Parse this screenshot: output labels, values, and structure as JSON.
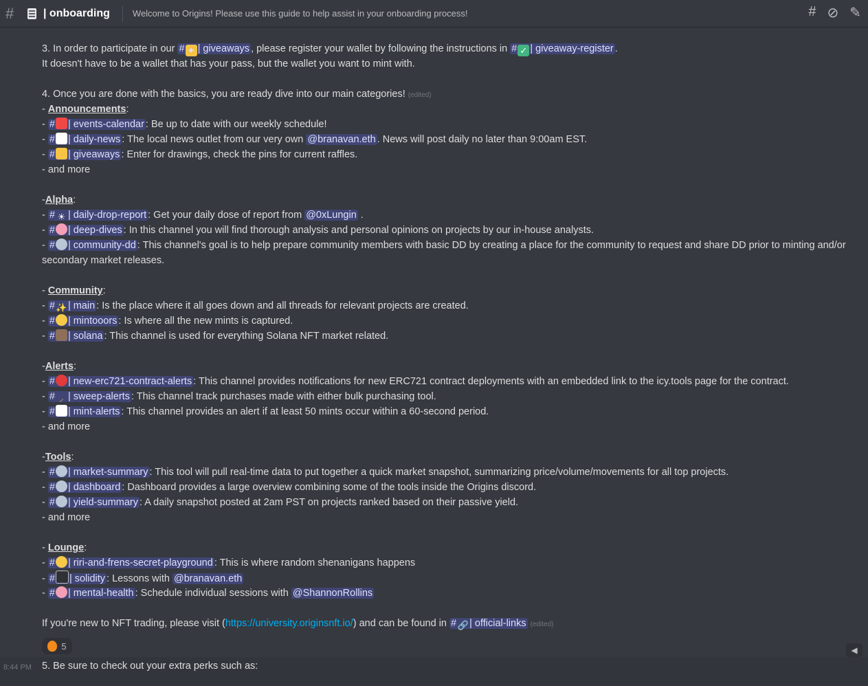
{
  "header": {
    "channel": "| onboarding",
    "topic": "Welcome to Origins! Please use this guide to help assist in your onboarding process!",
    "icons": [
      "threads-icon",
      "mute-icon",
      "pin-icon"
    ]
  },
  "lines": {
    "l3a": "3. In order to participate in our ",
    "l3_ch1": "| giveaways",
    "l3b": ", please register your wallet by following the instructions in ",
    "l3_ch2": "| giveaway-register",
    "l3c": ".",
    "l3d": "It doesn't have to be a wallet that has your pass, but the wallet you want to mint with.",
    "l4": "4. Once you are done with the basics, you are ready dive into our main categories!",
    "edited": "(edited)"
  },
  "announcements": {
    "prefix": "- ",
    "title": "Announcements",
    "items": [
      {
        "channel": "| events-calendar",
        "text": ": Be up to date with our weekly schedule!"
      },
      {
        "channel": "| daily-news",
        "text": ": The local news outlet from our very own ",
        "mention": "@branavan.eth",
        "tail": ". News will post daily no later than 9:00am EST."
      },
      {
        "channel": "| giveaways",
        "text": ": Enter for drawings, check the pins for current raffles."
      }
    ],
    "more": "- and more"
  },
  "alpha": {
    "prefix": "-",
    "title": "Alpha",
    "items": [
      {
        "channel": "| daily-drop-report",
        "text": ": Get your daily dose of report from ",
        "mention": "@0xLungin",
        "tail": " ."
      },
      {
        "channel": "| deep-dives",
        "text": ": In this channel you will find thorough analysis and personal opinions on projects by our in-house analysts."
      },
      {
        "channel": "| community-dd",
        "text": ": This channel's goal is to help prepare community members with basic DD by creating a place for the community to request and share DD prior to minting and/or secondary market releases."
      }
    ]
  },
  "community": {
    "prefix": "- ",
    "title": "Community",
    "items": [
      {
        "channel": "| main",
        "text": ": Is the place where it all goes down and all threads for relevant projects are created."
      },
      {
        "channel": "| mintooors",
        "text": ": Is where all the new mints is captured."
      },
      {
        "channel": "| solana",
        "text": ": This channel is used for everything Solana NFT market related."
      }
    ]
  },
  "alerts": {
    "prefix": "-",
    "title": "Alerts",
    "items": [
      {
        "channel": "| new-erc721-contract-alerts",
        "text": ": This channel provides notifications for new ERC721 contract deployments with an embedded link to the icy.tools page for the contract."
      },
      {
        "channel": "| sweep-alerts",
        "text": ": This channel track purchases made with either bulk purchasing tool."
      },
      {
        "channel": "| mint-alerts",
        "text": ": This channel provides an alert if at least 50 mints occur within a 60-second period."
      }
    ],
    "more": "- and more"
  },
  "tools": {
    "prefix": "-",
    "title": "Tools",
    "items": [
      {
        "channel": "| market-summary",
        "text": ": This tool will pull real-time data to put together a quick market snapshot, summarizing price/volume/movements for all top projects."
      },
      {
        "channel": "| dashboard",
        "text": ": Dashboard provides a large overview combining some of the tools inside the Origins discord."
      },
      {
        "channel": "| yield-summary",
        "text": ": A daily snapshot posted at 2am PST on projects ranked based on their passive yield."
      }
    ],
    "more": "- and more"
  },
  "lounge": {
    "prefix": "- ",
    "title": "Lounge",
    "items": [
      {
        "channel": "| riri-and-frens-secret-playground",
        "text": ": This is where random shenanigans happens"
      },
      {
        "channel": "| solidity",
        "text": ": Lessons with ",
        "mention": "@branavan.eth"
      },
      {
        "channel": "| mental-health",
        "text": ": Schedule individual sessions with ",
        "mention": "@ShannonRollins"
      }
    ]
  },
  "footer": {
    "a": "If you're new to NFT trading, please visit (",
    "link": "https://university.originsnft.io/",
    "b": ") and can be found in ",
    "channel": "| official-links",
    "edited": "(edited)"
  },
  "reaction": {
    "count": "5"
  },
  "next": {
    "time": "8:44 PM",
    "text": "5. Be sure to check out your extra perks such as:"
  }
}
